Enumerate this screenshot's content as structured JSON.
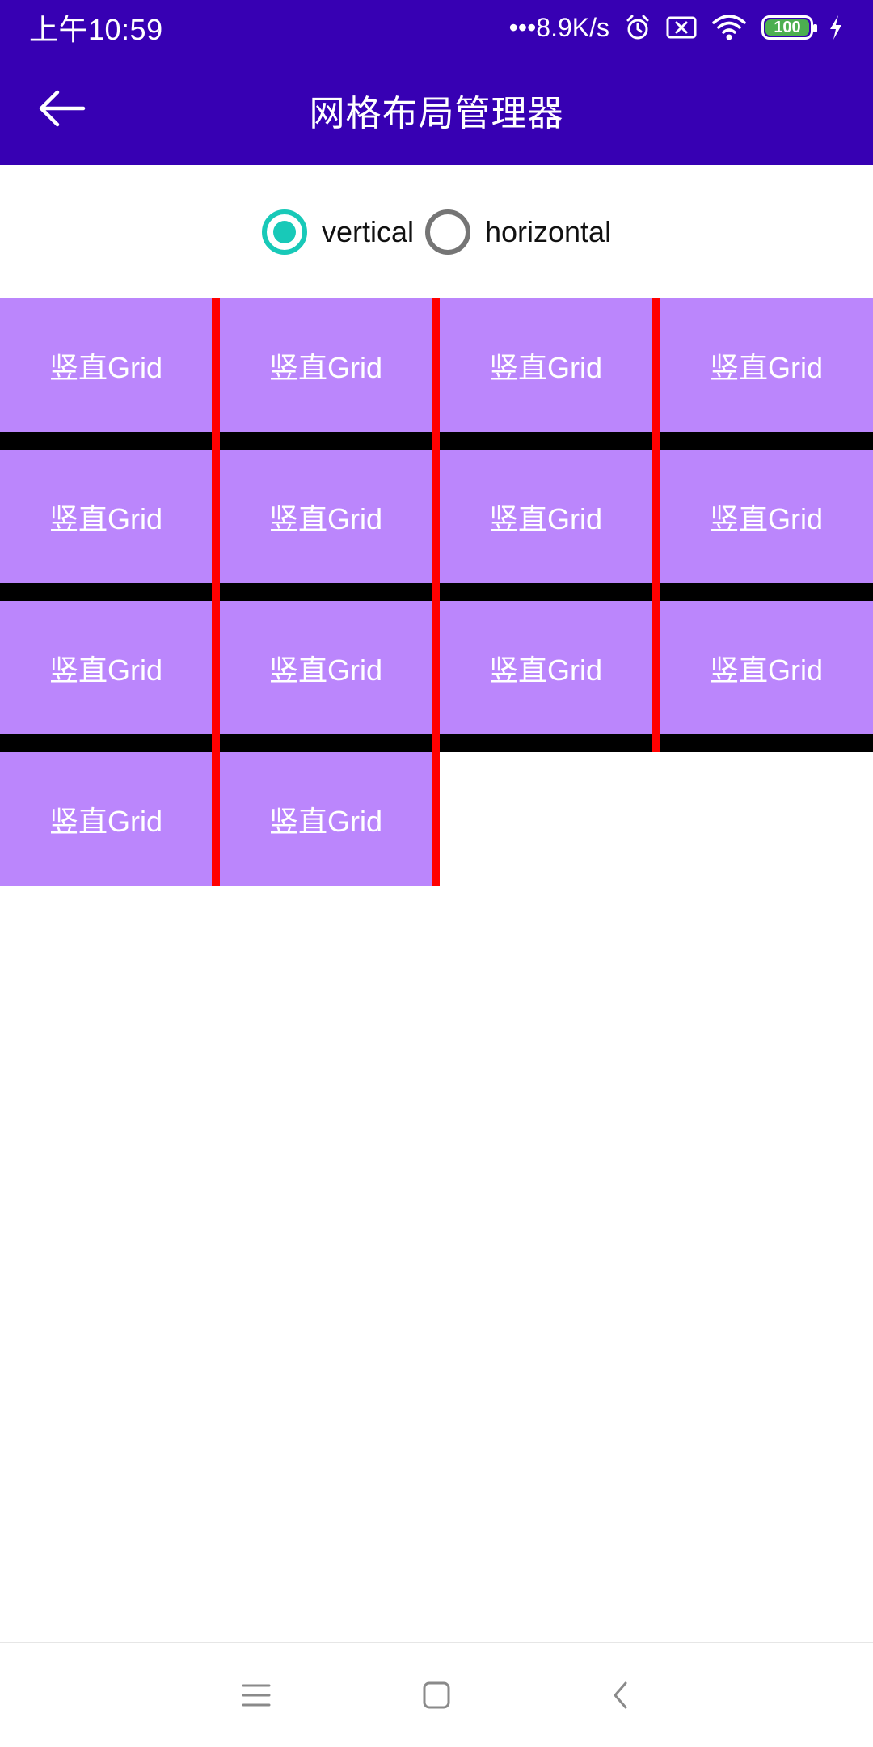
{
  "status_bar": {
    "time": "上午10:59",
    "network_speed": "•••8.9K/s",
    "battery": "100",
    "icons": [
      "alarm-icon",
      "sim-error-icon",
      "wifi-icon",
      "battery-icon",
      "charging-icon"
    ]
  },
  "app_bar": {
    "title": "网格布局管理器",
    "back_icon": "arrow-left-icon"
  },
  "orientation": {
    "options": [
      {
        "label": "vertical",
        "checked": true
      },
      {
        "label": "horizontal",
        "checked": false
      }
    ]
  },
  "grid": {
    "columns": 4,
    "items": [
      "竖直Grid",
      "竖直Grid",
      "竖直Grid",
      "竖直Grid",
      "竖直Grid",
      "竖直Grid",
      "竖直Grid",
      "竖直Grid",
      "竖直Grid",
      "竖直Grid",
      "竖直Grid",
      "竖直Grid",
      "竖直Grid",
      "竖直Grid"
    ],
    "colors": {
      "item": "#bb86fc",
      "horizontal_divider": "#000000",
      "vertical_divider": "#ff0000"
    }
  },
  "nav_bar": {
    "icons": [
      "menu-icon",
      "home-icon",
      "back-icon"
    ]
  },
  "colors": {
    "primary": "#3700b3",
    "accent": "#18c9b8"
  }
}
